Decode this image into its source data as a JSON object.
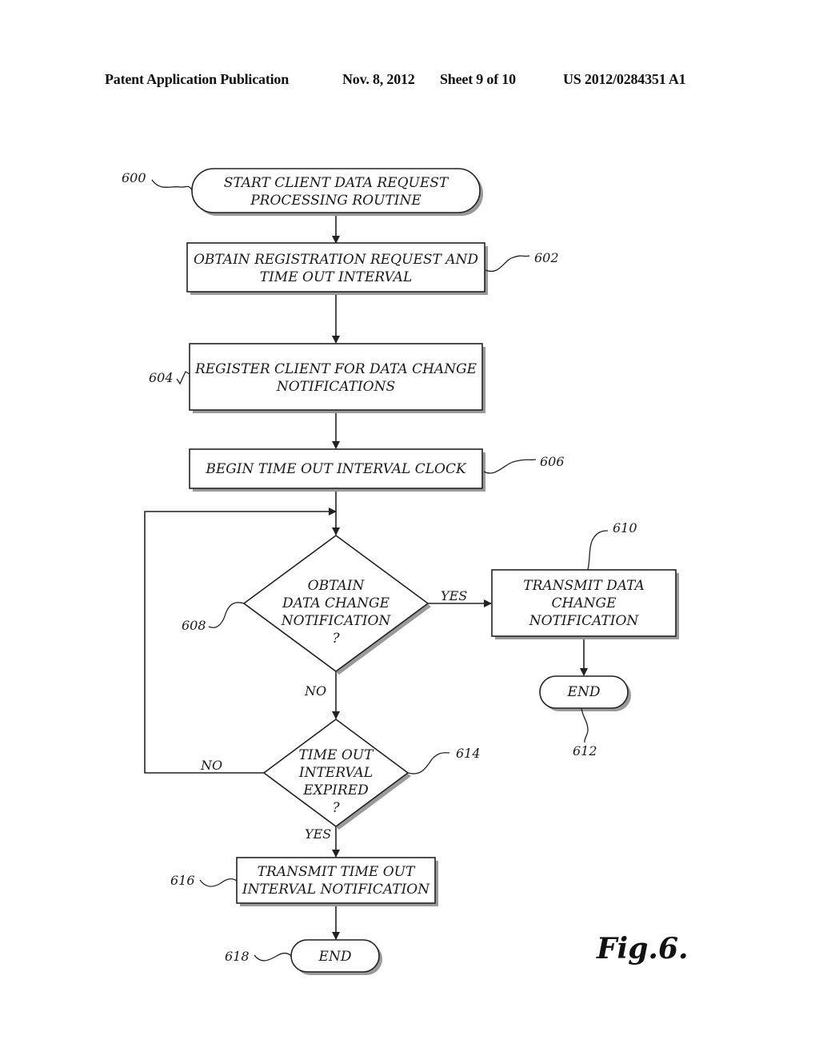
{
  "header": {
    "publication": "Patent Application Publication",
    "date": "Nov. 8, 2012",
    "sheet": "Sheet 9 of 10",
    "number": "US 2012/0284351 A1"
  },
  "figure_label": "Fig.6.",
  "nodes": {
    "n600": {
      "ref": "600",
      "type": "terminator",
      "lines": [
        "START CLIENT DATA REQUEST",
        "PROCESSING ROUTINE"
      ]
    },
    "n602": {
      "ref": "602",
      "type": "process",
      "lines": [
        "OBTAIN REGISTRATION REQUEST AND",
        "TIME OUT INTERVAL"
      ]
    },
    "n604": {
      "ref": "604",
      "type": "process",
      "lines": [
        "REGISTER CLIENT FOR DATA CHANGE",
        "NOTIFICATIONS"
      ]
    },
    "n606": {
      "ref": "606",
      "type": "process",
      "lines": [
        "BEGIN TIME OUT INTERVAL CLOCK"
      ]
    },
    "n608": {
      "ref": "608",
      "type": "decision",
      "lines": [
        "OBTAIN",
        "DATA CHANGE",
        "NOTIFICATION",
        "?"
      ]
    },
    "n610": {
      "ref": "610",
      "type": "process",
      "lines": [
        "TRANSMIT DATA",
        "CHANGE",
        "NOTIFICATION"
      ]
    },
    "n612": {
      "ref": "612",
      "type": "terminator",
      "lines": [
        "END"
      ]
    },
    "n614": {
      "ref": "614",
      "type": "decision",
      "lines": [
        "TIME OUT",
        "INTERVAL",
        "EXPIRED",
        "?"
      ]
    },
    "n616": {
      "ref": "616",
      "type": "process",
      "lines": [
        "TRANSMIT TIME OUT",
        "INTERVAL NOTIFICATION"
      ]
    },
    "n618": {
      "ref": "618",
      "type": "terminator",
      "lines": [
        "END"
      ]
    }
  },
  "edges": [
    {
      "from": "600",
      "to": "602",
      "label": ""
    },
    {
      "from": "602",
      "to": "604",
      "label": ""
    },
    {
      "from": "604",
      "to": "606",
      "label": ""
    },
    {
      "from": "606",
      "to": "608",
      "label": ""
    },
    {
      "from": "608",
      "to": "610",
      "label": "YES"
    },
    {
      "from": "608",
      "to": "614",
      "label": "NO"
    },
    {
      "from": "610",
      "to": "612",
      "label": ""
    },
    {
      "from": "614",
      "to": "608",
      "label": "NO"
    },
    {
      "from": "614",
      "to": "616",
      "label": "YES"
    },
    {
      "from": "616",
      "to": "618",
      "label": ""
    }
  ],
  "edge_labels": {
    "yes_608": "YES",
    "no_608": "NO",
    "no_614": "NO",
    "yes_614": "YES"
  }
}
